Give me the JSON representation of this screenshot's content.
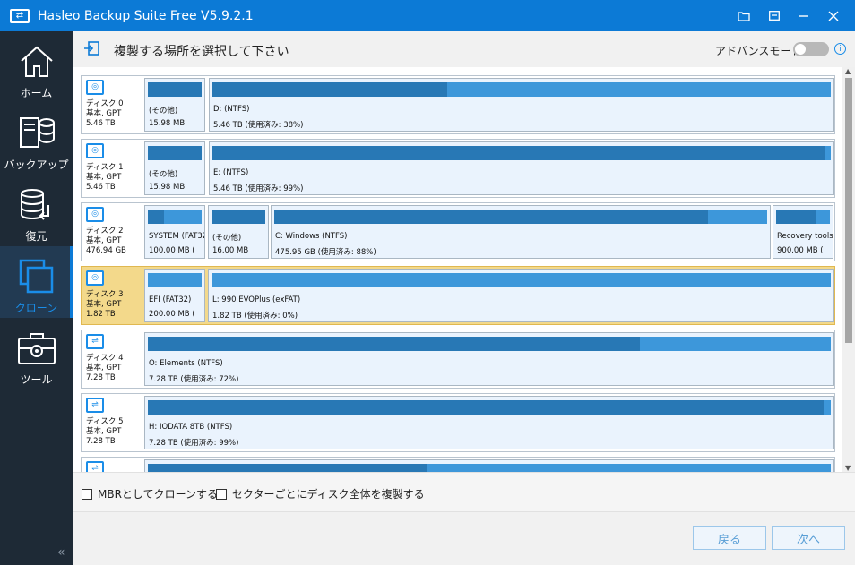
{
  "window": {
    "title": "Hasleo Backup Suite Free V5.9.2.1"
  },
  "titlebar_buttons": [
    "folder-open-icon",
    "maximize-icon",
    "minimize-icon",
    "close-icon"
  ],
  "sidebar": {
    "items": [
      {
        "label": "ホーム",
        "icon": "home-icon"
      },
      {
        "label": "バックアップ",
        "icon": "backup-icon"
      },
      {
        "label": "復元",
        "icon": "restore-icon"
      },
      {
        "label": "クローン",
        "icon": "clone-icon",
        "active": true
      },
      {
        "label": "ツール",
        "icon": "tools-icon"
      }
    ],
    "collapse_glyph": "«"
  },
  "header": {
    "title": "複製する場所を選択して下さい",
    "advanced_mode_label": "アドバンスモード",
    "advanced_mode_on": false
  },
  "disks": [
    {
      "name": "ディスク 0",
      "type": "基本, GPT",
      "size": "5.46 TB",
      "icon": "disk-icon",
      "partitions": [
        {
          "name": "(その他)",
          "size": "15.98 MB",
          "used": 1.0
        },
        {
          "name": "D: (NTFS)",
          "size": "5.46 TB (使用済み: 38%)",
          "used": 0.38
        }
      ]
    },
    {
      "name": "ディスク 1",
      "type": "基本, GPT",
      "size": "5.46 TB",
      "icon": "disk-icon",
      "partitions": [
        {
          "name": "(その他)",
          "size": "15.98 MB",
          "used": 1.0
        },
        {
          "name": "E: (NTFS)",
          "size": "5.46 TB (使用済み: 99%)",
          "used": 0.99
        }
      ]
    },
    {
      "name": "ディスク 2",
      "type": "基本, GPT",
      "size": "476.94 GB",
      "icon": "disk-icon",
      "partitions": [
        {
          "name": "SYSTEM (FAT32)",
          "size": "100.00 MB (",
          "used": 0.3
        },
        {
          "name": "(その他)",
          "size": "16.00 MB",
          "used": 1.0
        },
        {
          "name": "C: Windows (NTFS)",
          "size": "475.95 GB (使用済み: 88%)",
          "used": 0.88
        },
        {
          "name": "Recovery tools",
          "size": "900.00 MB (",
          "used": 0.75
        }
      ]
    },
    {
      "name": "ディスク 3",
      "type": "基本, GPT",
      "size": "1.82 TB",
      "icon": "disk-icon",
      "selected": true,
      "partitions": [
        {
          "name": "EFI (FAT32)",
          "size": "200.00 MB (",
          "used": 0.0
        },
        {
          "name": "L: 990 EVOPlus (exFAT)",
          "size": "1.82 TB (使用済み: 0%)",
          "used": 0.0
        }
      ]
    },
    {
      "name": "ディスク 4",
      "type": "基本, GPT",
      "size": "7.28 TB",
      "icon": "usb-disk-icon",
      "partitions": [
        {
          "name": "O: Elements (NTFS)",
          "size": "7.28 TB (使用済み: 72%)",
          "used": 0.72
        }
      ]
    },
    {
      "name": "ディスク 5",
      "type": "基本, GPT",
      "size": "7.28 TB",
      "icon": "usb-disk-icon",
      "partitions": [
        {
          "name": "H: IODATA 8TB (NTFS)",
          "size": "7.28 TB (使用済み: 99%)",
          "used": 0.99
        }
      ]
    },
    {
      "name": "",
      "type": "",
      "size": "",
      "icon": "usb-disk-icon",
      "partitions": [
        {
          "name": "",
          "size": "",
          "used": 0.41
        }
      ]
    }
  ],
  "options": {
    "mbr_clone": {
      "label": "MBRとしてクローンする",
      "checked": false
    },
    "sector_clone": {
      "label": "セクターごとにディスク全体を複製する",
      "checked": false
    }
  },
  "footer": {
    "back_label": "戻る",
    "next_label": "次へ"
  }
}
